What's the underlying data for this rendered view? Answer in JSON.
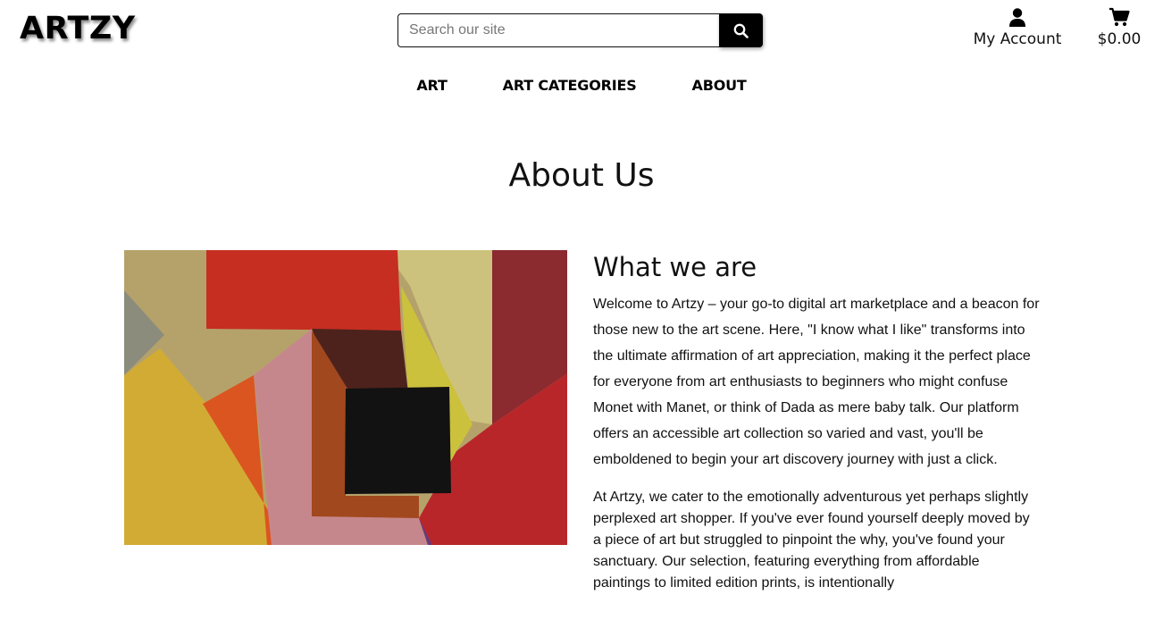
{
  "header": {
    "logo": "ARTZY",
    "search": {
      "placeholder": "Search our site",
      "value": "",
      "button_icon": "search-icon"
    },
    "account": {
      "icon": "user-icon",
      "label": "My Account"
    },
    "cart": {
      "icon": "cart-icon",
      "label": "$0.00"
    }
  },
  "nav": {
    "items": [
      {
        "label": "ART"
      },
      {
        "label": "ART CATEGORIES"
      },
      {
        "label": "ABOUT"
      }
    ]
  },
  "main": {
    "title": "About Us",
    "hero_image": {
      "colors": {
        "red": "#c42a1f",
        "yellow": "#d3b033",
        "pink": "#c7878b",
        "black": "#121212",
        "maroon": "#8a2a2e",
        "beige": "#b8a873",
        "orange": "#d9531e",
        "gray": "#8a8a7a"
      }
    },
    "section": {
      "heading": "What we are",
      "paragraphs": [
        "Welcome to Artzy – your go-to digital art marketplace and a beacon for those new to the art scene. Here, \"I know what I like\" transforms into the ultimate affirmation of art appreciation, making it the perfect place for everyone from art enthusiasts to beginners who might confuse Monet with Manet, or think of Dada as mere baby talk. Our platform offers an accessible art collection so varied and vast, you'll be emboldened to begin your art discovery journey with just a click.",
        "At Artzy, we cater to the emotionally adventurous yet perhaps slightly perplexed art shopper. If you've ever found yourself deeply moved by a piece of art but struggled to pinpoint the why, you've found your sanctuary. Our selection, featuring everything from affordable paintings to limited edition prints, is intentionally"
      ]
    }
  }
}
